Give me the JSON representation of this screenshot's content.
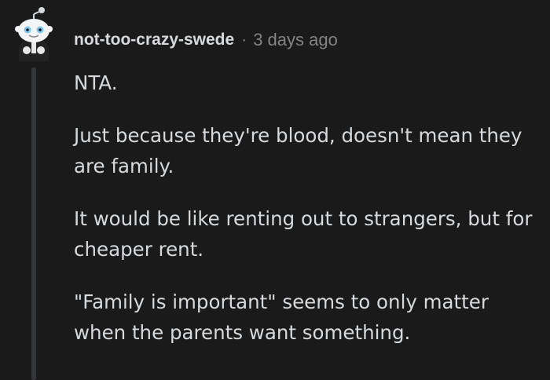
{
  "comment": {
    "username": "not-too-crazy-swede",
    "separator": "·",
    "timestamp": "3 days ago",
    "paragraphs": [
      "NTA.",
      "Just because they're blood, doesn't mean they are family.",
      "It would be like renting out to strangers, but for cheaper rent.",
      "\"Family is important\" seems to only matter when the parents want something."
    ]
  },
  "icons": {
    "avatar": "snoo-avatar-icon"
  },
  "colors": {
    "background": "#1a1a1b",
    "text": "#d7dadc",
    "muted": "#818384",
    "thread_line": "#343536",
    "avatar_eyes": "#7ec8f0"
  }
}
